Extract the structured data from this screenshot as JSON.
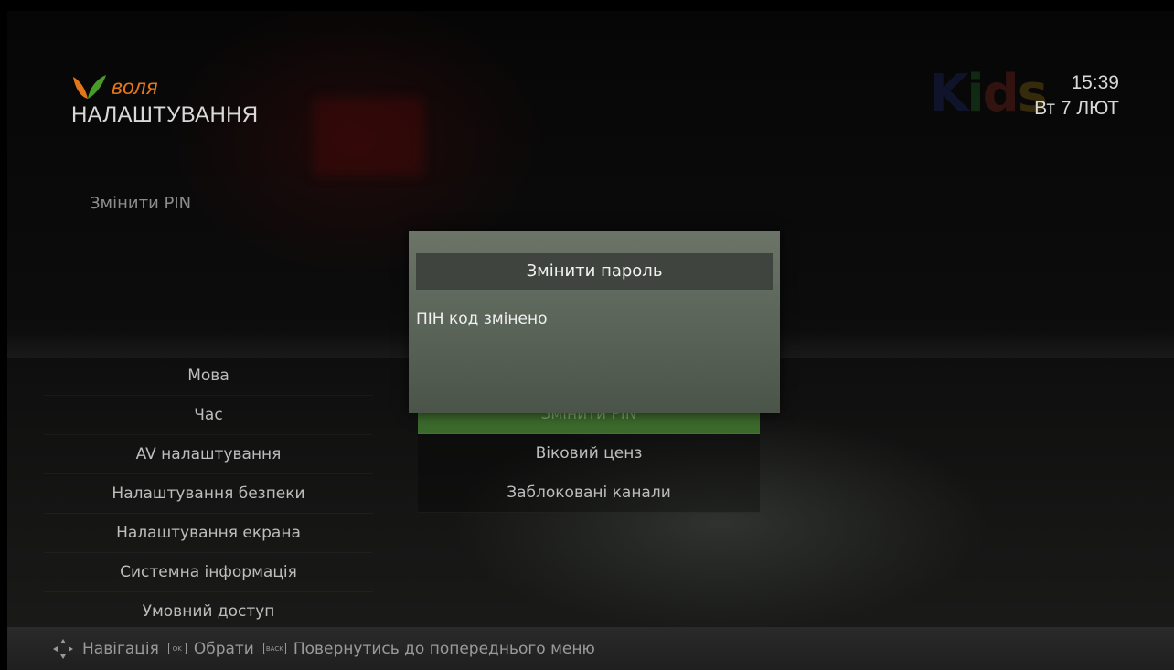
{
  "header": {
    "brand": "воля",
    "section_title": "НАЛАШТУВАННЯ",
    "time": "15:39",
    "date": "Вт 7 ЛЮТ",
    "brand_color": "#e2771a"
  },
  "background_channel_logo": "Kids",
  "description": "Змінити PIN",
  "menu_left": {
    "items": [
      {
        "label": "Мова"
      },
      {
        "label": "Час"
      },
      {
        "label": "AV налаштування"
      },
      {
        "label": "Налаштування безпеки"
      },
      {
        "label": "Налаштування екрана"
      },
      {
        "label": "Системна інформація"
      },
      {
        "label": "Умовний доступ"
      }
    ]
  },
  "menu_right": {
    "items": [
      {
        "label": "Змінити PIN",
        "active": true
      },
      {
        "label": "Віковий ценз"
      },
      {
        "label": "Заблоковані канали"
      }
    ]
  },
  "dialog": {
    "title": "Змінити пароль",
    "message": "ПІН код змінено"
  },
  "footer": {
    "navigate_label": "Навігація",
    "ok_key": "OK",
    "select_label": "Обрати",
    "back_key": "BACK",
    "back_label": "Повернутись до попереднього меню"
  }
}
